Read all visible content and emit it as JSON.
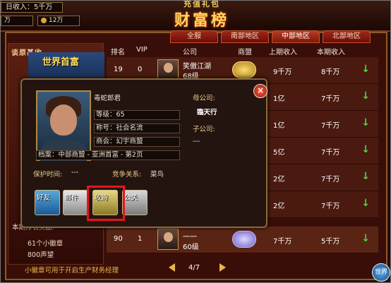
{
  "top": {
    "daily_income": "日收入：5千万",
    "res_left": "万",
    "res_right": "12万",
    "banner_sub": "充值礼包",
    "banner_main": "财富榜"
  },
  "tabs": [
    "全服",
    "南部地区",
    "中部地区",
    "北部地区"
  ],
  "active_tab": "中部地区",
  "left_panel": {
    "title": "谈原基收",
    "first_rich": "世界首富",
    "reward_title": "本期排名奖励:",
    "reward_line1": "61个小徽章",
    "reward_line2": "800声望"
  },
  "table": {
    "headers": [
      "排名",
      "VIP",
      "公司",
      "商盟",
      "上期收入",
      "本期收入"
    ],
    "rows": [
      {
        "rank": "19",
        "vip": "0",
        "company": "笑傲江湖",
        "level": "68级",
        "alliance": "",
        "last": "9千万",
        "now": "8千万"
      },
      {
        "rank": "",
        "vip": "",
        "company": "",
        "level": "",
        "alliance": "",
        "last": "1亿",
        "now": "7千万"
      },
      {
        "rank": "",
        "vip": "",
        "company": "",
        "level": "",
        "alliance": "",
        "last": "1亿",
        "now": "7千万"
      },
      {
        "rank": "",
        "vip": "",
        "company": "",
        "level": "",
        "alliance": "",
        "last": "5亿",
        "now": "7千万"
      },
      {
        "rank": "",
        "vip": "",
        "company": "",
        "level": "",
        "alliance": "",
        "last": "2亿",
        "now": "7千万"
      },
      {
        "rank": "",
        "vip": "",
        "company": "",
        "level": "",
        "alliance": "",
        "last": "2亿",
        "now": "7千万"
      },
      {
        "rank": "90",
        "vip": "1",
        "company": "一一",
        "level": "60级",
        "alliance": "",
        "last": "7千万",
        "now": "5千万"
      }
    ],
    "arrow_symbol": "↓"
  },
  "popup": {
    "name": "毒蛇郎君",
    "level": "等级：65",
    "title": "称号：社会名流",
    "alliance": "商会：幻宇商盟",
    "archive": "档案：中部商盟 - 亚洲首富 - 第2页",
    "parent_label": "母公司:",
    "parent_value": "臨天行",
    "child_label": "子公司:",
    "child_value": "---",
    "protect_label": "保护时间:",
    "protect_value": "---",
    "rival_label": "竞争关系:",
    "rival_value": "菜鸟",
    "close_symbol": "×",
    "actions": [
      "好友",
      "邮件",
      "收购",
      "公关"
    ]
  },
  "footer": {
    "tip": "小徽章可用于开启生产财务经理",
    "page": "4/7",
    "world": "世界"
  },
  "colors": {
    "highlight": "#e8141c",
    "arrow_down": "#48d848",
    "gold": "#e8b848"
  }
}
